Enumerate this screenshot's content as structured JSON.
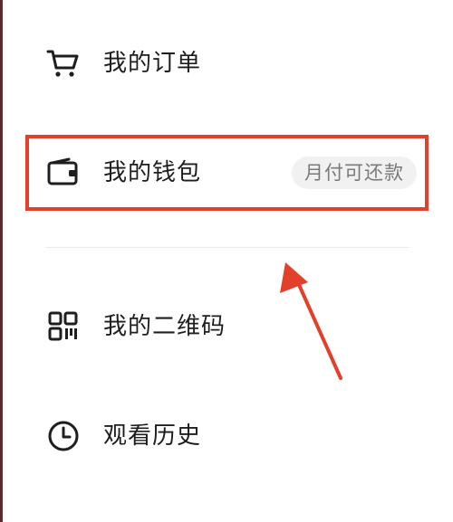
{
  "menu": {
    "orders": {
      "label": "我的订单",
      "icon": "cart-icon"
    },
    "wallet": {
      "label": "我的钱包",
      "icon": "wallet-icon",
      "badge": "月付可还款"
    },
    "qrcode": {
      "label": "我的二维码",
      "icon": "qr-code-icon"
    },
    "history": {
      "label": "观看历史",
      "icon": "clock-icon"
    }
  },
  "colors": {
    "highlight": "#e2402a",
    "arrow": "#e2402a",
    "text": "#1e1e1e",
    "badge_bg": "#f1f1f1",
    "badge_text": "#7a7a7a"
  }
}
